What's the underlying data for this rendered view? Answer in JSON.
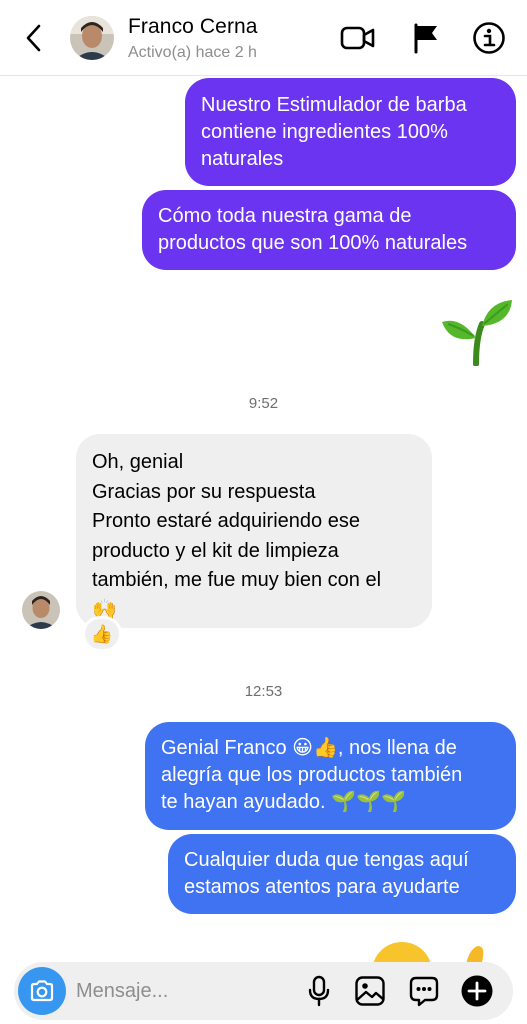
{
  "header": {
    "contact_name": "Franco Cerna",
    "status": "Activo(a) hace 2 h",
    "icons": [
      "back-icon",
      "video-call-icon",
      "flag-icon",
      "info-icon"
    ]
  },
  "messages": [
    {
      "direction": "outgoing",
      "color": "#6b34f0",
      "lines": [
        "Nuestro Estimulador de barba",
        "contiene ingredientes 100%",
        "naturales"
      ]
    },
    {
      "direction": "outgoing",
      "color": "#6b34f0",
      "lines": [
        "Cómo toda nuestra gama de",
        "productos que son 100% naturales"
      ]
    },
    {
      "direction": "outgoing",
      "emoji": "🌱"
    },
    {
      "type": "timestamp",
      "text": "9:52"
    },
    {
      "direction": "incoming",
      "lines": [
        "Oh, genial",
        "Gracias por su respuesta",
        "Pronto estaré adquiriendo ese",
        "producto y el kit de limpieza",
        "también, me fue muy bien con el",
        "🙌"
      ],
      "reaction": "👍"
    },
    {
      "type": "timestamp",
      "text": "12:53"
    },
    {
      "direction": "outgoing",
      "color": "#3f73f1",
      "lines": [
        "Genial Franco 😀👍, nos llena de",
        "alegría que los productos también",
        "te hayan ayudado. 🌱🌱🌱"
      ]
    },
    {
      "direction": "outgoing",
      "color": "#3f73f1",
      "lines": [
        "Cualquier duda que tengas aquí",
        "estamos atentos para ayudarte"
      ]
    }
  ],
  "composer": {
    "placeholder": "Mensaje...",
    "icons": [
      "camera-icon",
      "microphone-icon",
      "image-icon",
      "sticker-icon",
      "plus-icon"
    ]
  },
  "colors": {
    "outgoing_purple": "#6b34f0",
    "outgoing_blue": "#3f73f1",
    "incoming_grey": "#efefef",
    "camera_button": "#3797f0"
  }
}
